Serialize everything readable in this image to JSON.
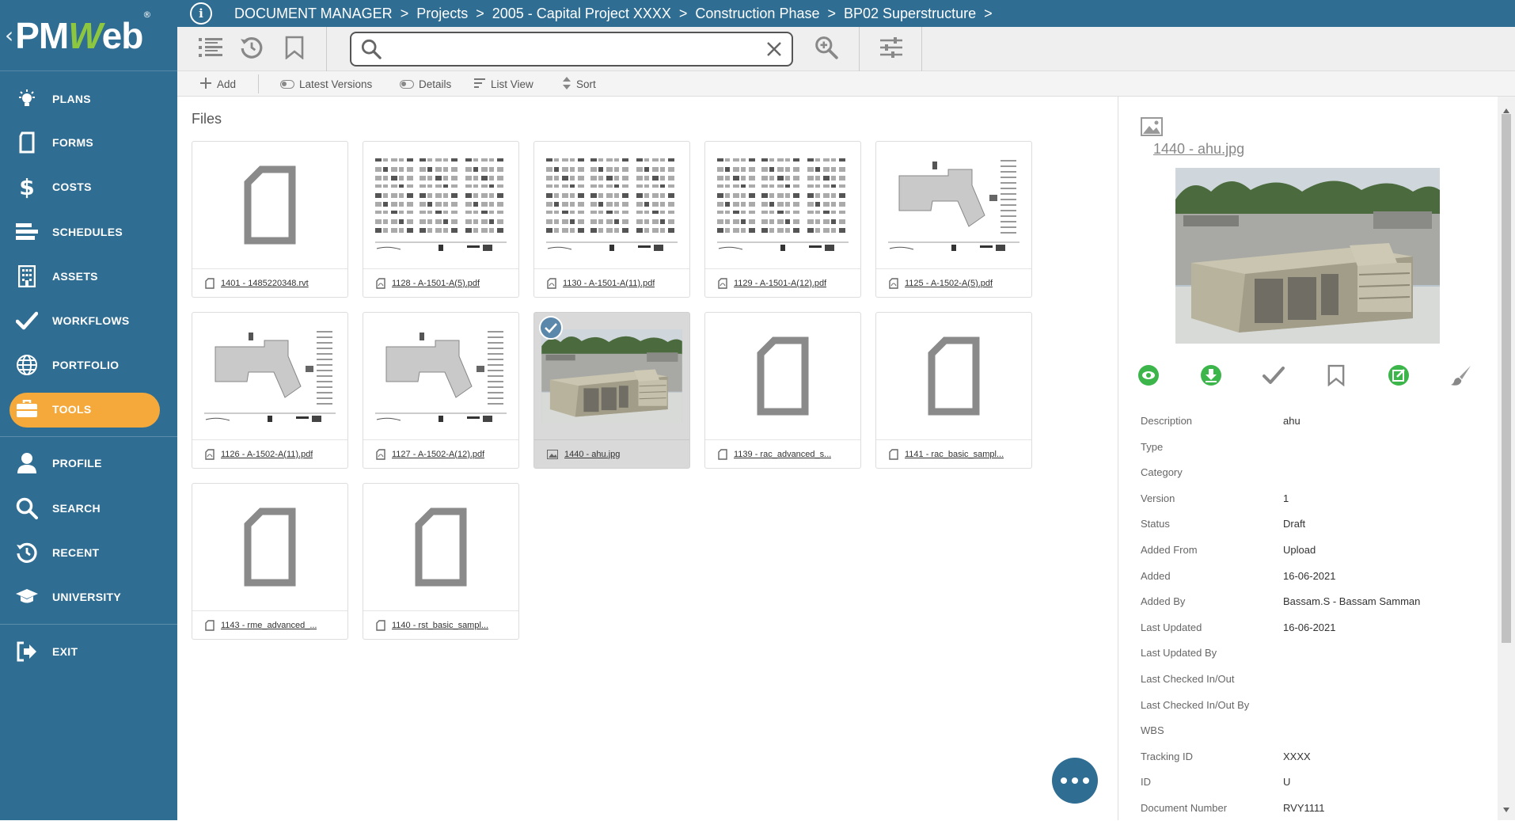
{
  "app": {
    "logo_text": "PMWeb",
    "logo_mark": "®",
    "back_chevron": "‹"
  },
  "breadcrumb": [
    "DOCUMENT MANAGER",
    "Projects",
    "2005 - Capital Project XXXX",
    "Construction Phase",
    "BP02 Superstructure"
  ],
  "breadcrumb_sep": ">",
  "info_icon_glyph": "i",
  "sidebar": {
    "items": [
      {
        "label": "PLANS",
        "icon": "lightbulb-icon"
      },
      {
        "label": "FORMS",
        "icon": "form-icon"
      },
      {
        "label": "COSTS",
        "icon": "dollar-icon"
      },
      {
        "label": "SCHEDULES",
        "icon": "schedule-icon"
      },
      {
        "label": "ASSETS",
        "icon": "building-icon"
      },
      {
        "label": "WORKFLOWS",
        "icon": "check-icon"
      },
      {
        "label": "PORTFOLIO",
        "icon": "globe-icon"
      },
      {
        "label": "TOOLS",
        "icon": "toolbox-icon",
        "active": true
      },
      {
        "label": "PROFILE",
        "icon": "user-icon"
      },
      {
        "label": "SEARCH",
        "icon": "search-icon"
      },
      {
        "label": "RECENT",
        "icon": "history-icon"
      },
      {
        "label": "UNIVERSITY",
        "icon": "graduation-cap-icon"
      },
      {
        "label": "EXIT",
        "icon": "exit-icon"
      }
    ],
    "active_color": "#f5a93b",
    "background": "#2f6d92"
  },
  "search": {
    "value": "",
    "placeholder": ""
  },
  "actions": {
    "add": "Add",
    "latest_versions": "Latest Versions",
    "details": "Details",
    "list_view": "List View",
    "sort": "Sort"
  },
  "files": {
    "title": "Files",
    "items": [
      {
        "name": "1401 - 1485220348.rvt",
        "type": "blank"
      },
      {
        "name": "1128 - A-1501-A(5).pdf",
        "type": "pdf-sheet"
      },
      {
        "name": "1130 - A-1501-A(11).pdf",
        "type": "pdf-sheet"
      },
      {
        "name": "1129 - A-1501-A(12).pdf",
        "type": "pdf-sheet"
      },
      {
        "name": "1125 - A-1502-A(5).pdf",
        "type": "pdf-plan"
      },
      {
        "name": "1126 - A-1502-A(11).pdf",
        "type": "pdf-plan"
      },
      {
        "name": "1127 - A-1502-A(12).pdf",
        "type": "pdf-plan"
      },
      {
        "name": "1440 - ahu.jpg",
        "type": "image",
        "selected": true
      },
      {
        "name": "1139 - rac_advanced_s...",
        "type": "blank"
      },
      {
        "name": "1141 - rac_basic_sampl...",
        "type": "blank"
      },
      {
        "name": "1143 - rme_advanced_...",
        "type": "blank"
      },
      {
        "name": "1140 - rst_basic_sampl...",
        "type": "blank"
      }
    ]
  },
  "preview": {
    "file_name": "1440 - ahu.jpg",
    "actions": [
      "view-icon",
      "download-icon",
      "checkmark-icon",
      "bookmark-icon",
      "edit-icon",
      "brush-icon"
    ],
    "properties": [
      {
        "key": "Description",
        "value": "ahu"
      },
      {
        "key": "Type",
        "value": ""
      },
      {
        "key": "Category",
        "value": ""
      },
      {
        "key": "Version",
        "value": "1"
      },
      {
        "key": "Status",
        "value": "Draft"
      },
      {
        "key": "Added From",
        "value": "Upload"
      },
      {
        "key": "Added",
        "value": "16-06-2021"
      },
      {
        "key": "Added By",
        "value": "Bassam.S - Bassam Samman"
      },
      {
        "key": "Last Updated",
        "value": "16-06-2021"
      },
      {
        "key": "Last Updated By",
        "value": ""
      },
      {
        "key": "Last Checked In/Out",
        "value": ""
      },
      {
        "key": "Last Checked In/Out By",
        "value": ""
      },
      {
        "key": "WBS",
        "value": ""
      },
      {
        "key": "Tracking ID",
        "value": "XXXX"
      },
      {
        "key": "ID",
        "value": "U"
      },
      {
        "key": "Document Number",
        "value": "RVY1111"
      }
    ]
  },
  "colors": {
    "brand": "#2f6d92",
    "accent": "#f5a93b",
    "green_action": "#3cb54a",
    "selected_card": "#d9d9d9"
  }
}
